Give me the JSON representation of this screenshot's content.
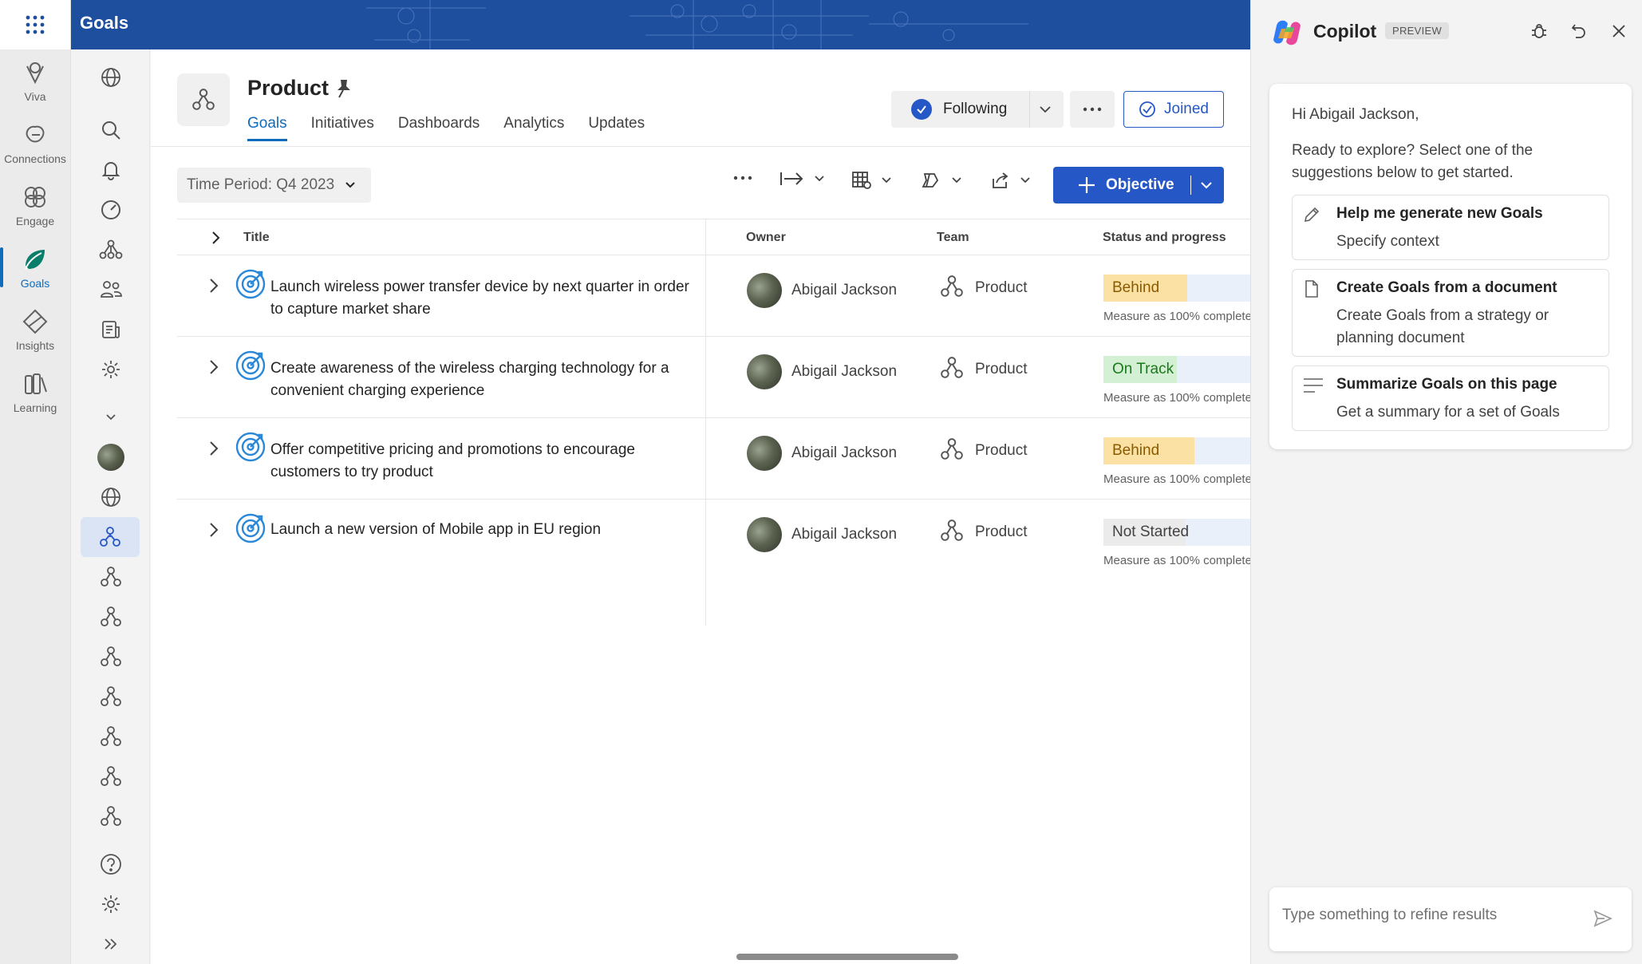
{
  "app": {
    "title": "Goals"
  },
  "rail": {
    "items": [
      {
        "label": "Viva",
        "icon": "viva-icon"
      },
      {
        "label": "Connections",
        "icon": "connections-icon"
      },
      {
        "label": "Engage",
        "icon": "engage-icon"
      },
      {
        "label": "Goals",
        "icon": "goals-icon",
        "active": true
      },
      {
        "label": "Insights",
        "icon": "insights-icon"
      },
      {
        "label": "Learning",
        "icon": "learning-icon"
      }
    ]
  },
  "page": {
    "title": "Product",
    "tabs": [
      "Goals",
      "Initiatives",
      "Dashboards",
      "Analytics",
      "Updates"
    ],
    "active_tab": "Goals",
    "following_label": "Following",
    "joined_label": "Joined"
  },
  "toolbar": {
    "time_period": "Time Period: Q4 2023",
    "objective_label": "Objective"
  },
  "table": {
    "headers": {
      "title": "Title",
      "owner": "Owner",
      "team": "Team",
      "status": "Status and progress"
    },
    "rows": [
      {
        "title": "Launch wireless power transfer device by next quarter in order to capture market share",
        "owner": "Abigail Jackson",
        "team": "Product",
        "status": "Behind",
        "status_color": "#fbe2a4",
        "status_text_color": "#8a5a00",
        "progress": 0.57,
        "measure": "Measure as 100% complete"
      },
      {
        "title": "Create awareness of the wireless charging technology for a convenient charging experience",
        "owner": "Abigail Jackson",
        "team": "Product",
        "status": "On Track",
        "status_color": "#d4f0d4",
        "status_text_color": "#1a7a1a",
        "progress": 0.5,
        "measure": "Measure as 100% complete"
      },
      {
        "title": "Offer competitive pricing and promotions to encourage customers to try product",
        "owner": "Abigail Jackson",
        "team": "Product",
        "status": "Behind",
        "status_color": "#fbe2a4",
        "status_text_color": "#8a5a00",
        "progress": 0.62,
        "measure": "Measure as 100% complete"
      },
      {
        "title": "Launch a new version of Mobile app in EU region",
        "owner": "Abigail Jackson",
        "team": "Product",
        "status": "Not Started",
        "status_color": "#ebebeb",
        "status_text_color": "#424242",
        "progress": 0.0,
        "measure": "Measure as 100% complete"
      }
    ]
  },
  "copilot": {
    "title": "Copilot",
    "badge": "PREVIEW",
    "greeting": "Hi Abigail Jackson,",
    "intro": "Ready to explore? Select one of the suggestions below to get started.",
    "suggestions": [
      {
        "title": "Help me generate new Goals",
        "subtitle": "Specify context",
        "icon": "pencil-icon"
      },
      {
        "title": "Create Goals from a document",
        "subtitle": "Create Goals from a strategy or planning document",
        "icon": "document-icon"
      },
      {
        "title": "Summarize Goals on this page",
        "subtitle": "Get a summary for a set of Goals",
        "icon": "lines-icon"
      }
    ],
    "input_placeholder": "Type something to refine results"
  },
  "colors": {
    "accent": "#2557c7",
    "header": "#1d4f9e"
  }
}
